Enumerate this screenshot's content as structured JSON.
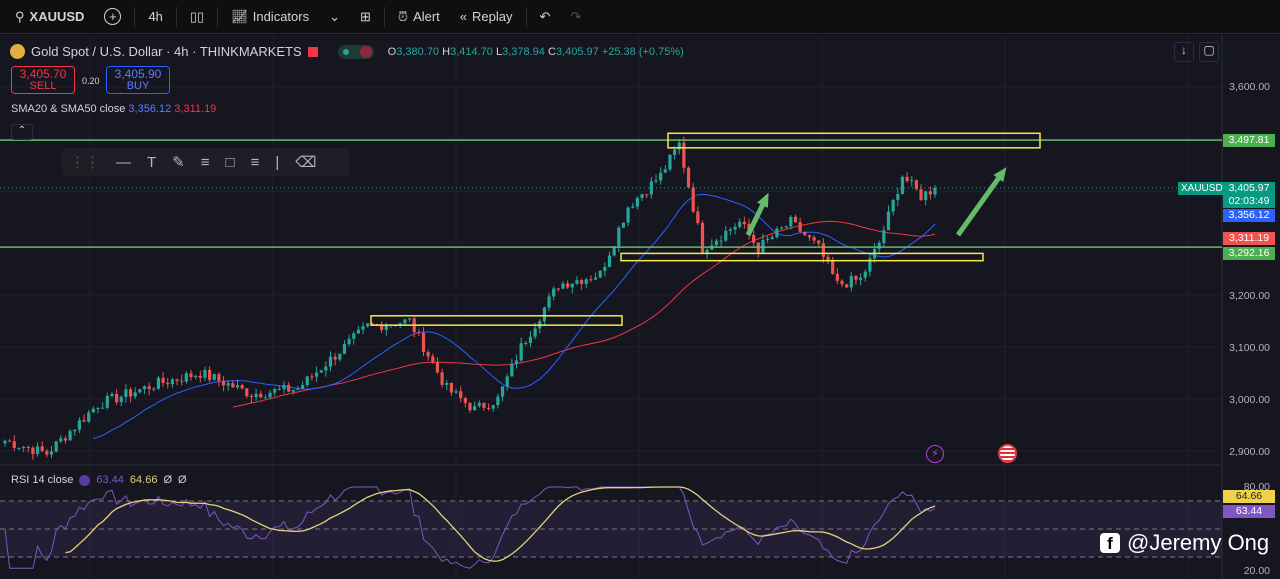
{
  "toolbar": {
    "symbol": "XAUUSD",
    "interval": "4h",
    "indicators": "Indicators",
    "alert": "Alert",
    "replay": "Replay"
  },
  "legend": {
    "title": "Gold Spot / U.S. Dollar · 4h · THINKMARKETS",
    "o_label": "O",
    "o": "3,380.70",
    "h_label": "H",
    "h": "3,414.70",
    "l_label": "L",
    "l": "3,378.94",
    "c_label": "C",
    "c": "3,405.97",
    "change": "+25.38 (+0.75%)"
  },
  "trade": {
    "sell_price": "3,405.70",
    "sell_label": "SELL",
    "spread": "0.20",
    "buy_price": "3,405.90",
    "buy_label": "BUY"
  },
  "sma": {
    "label": "SMA20 & SMA50 close",
    "sma20": "3,356.12",
    "sma50": "3,311.19"
  },
  "rsi": {
    "label": "RSI 14 close",
    "rsi": "63.44",
    "rsi_ma": "64.66",
    "extra1": "Ø",
    "extra2": "Ø"
  },
  "price_labels": {
    "symbol": "XAUUSD",
    "current": "3,405.97",
    "countdown": "02:03:49",
    "sma20": "3,356.12",
    "sma50": "3,311.19",
    "resistance": "3,497.81",
    "support": "3,292.16",
    "rsi_ma": "64.66",
    "rsi": "63.44"
  },
  "price_axis": [
    "3,600.00",
    "3,200.00",
    "3,100.00",
    "3,000.00",
    "2,900.00"
  ],
  "rsi_axis": [
    "80.00",
    "20.00"
  ],
  "watermark": "@Jeremy Ong",
  "colors": {
    "up": "#26a69a",
    "down": "#ef5350",
    "sma20": "#2962ff",
    "sma50": "#f23645",
    "rsi": "#7e57c2",
    "rsi_ma": "#e6d27a",
    "levels": "#66bb6a",
    "boxes": "#f5e94a"
  },
  "chart_data": {
    "type": "candlestick",
    "symbol": "XAUUSD",
    "timeframe": "4h",
    "price_range": [
      2880,
      3640
    ],
    "price_ticks": [
      2900,
      3000,
      3100,
      3200,
      3600
    ],
    "horizontal_levels": [
      3497.81,
      3292.16
    ],
    "last_close": 3405.97,
    "sma20_last": 3356.12,
    "sma50_last": 3311.19,
    "approx_close_path": [
      [
        0,
        2920
      ],
      [
        9,
        2895
      ],
      [
        20,
        2990
      ],
      [
        33,
        3030
      ],
      [
        42,
        3050
      ],
      [
        53,
        3010
      ],
      [
        63,
        3020
      ],
      [
        78,
        3140
      ],
      [
        87,
        3150
      ],
      [
        95,
        3020
      ],
      [
        101,
        2980
      ],
      [
        106,
        3000
      ],
      [
        111,
        3100
      ],
      [
        119,
        3220
      ],
      [
        128,
        3240
      ],
      [
        134,
        3370
      ],
      [
        141,
        3430
      ],
      [
        145,
        3490
      ],
      [
        150,
        3290
      ],
      [
        158,
        3340
      ],
      [
        162,
        3290
      ],
      [
        169,
        3340
      ],
      [
        175,
        3290
      ],
      [
        179,
        3220
      ],
      [
        184,
        3230
      ],
      [
        188,
        3300
      ],
      [
        193,
        3430
      ],
      [
        197,
        3390
      ],
      [
        200,
        3406
      ]
    ],
    "rsi_range": [
      20,
      80
    ],
    "rsi_levels": [
      70,
      50,
      30
    ],
    "rsi_last": 63.44,
    "rsi_ma_last": 64.66
  }
}
